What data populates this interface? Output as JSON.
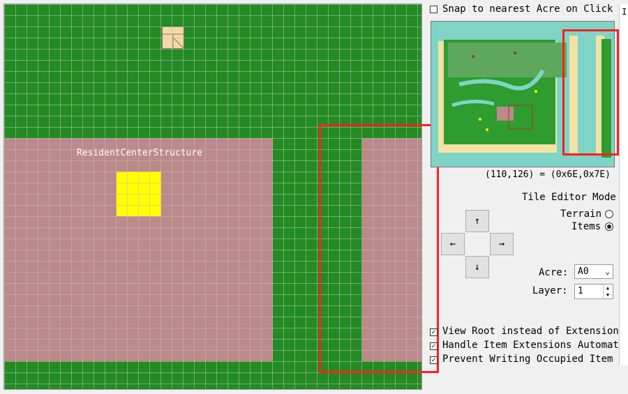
{
  "map": {
    "structure_label": "ResidentCenterStructure"
  },
  "panel": {
    "snap_label": "Snap to nearest Acre on Click",
    "coords": "(110,126) = (0x6E,0x7E)",
    "mode_title": "Tile Editor Mode",
    "terrain_label": "Terrain",
    "items_label": "Items",
    "acre_label": "Acre:",
    "acre_value": "A0",
    "layer_label": "Layer:",
    "layer_value": "1",
    "view_root_label": "View Root instead of Extension",
    "handle_ext_label": "Handle Item Extensions Automatic",
    "prevent_label": "Prevent Writing Occupied Item Ti",
    "side_letter": "I"
  },
  "arrows": {
    "up": "↑",
    "left": "←",
    "right": "→",
    "down": "↓"
  },
  "colors": {
    "grass": "#228b22",
    "structure": "#bc8a8a",
    "highlight": "#ffff00",
    "annotation": "#ff2020",
    "water": "#7fd4c6"
  }
}
